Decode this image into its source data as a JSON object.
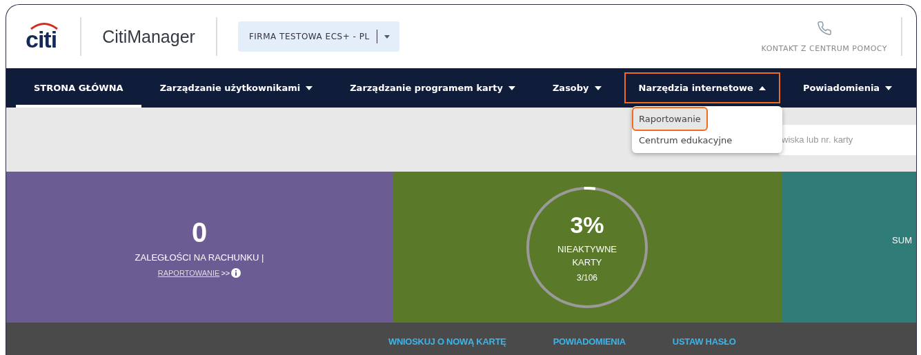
{
  "header": {
    "logo": "citi",
    "app_title": "CitiManager",
    "company_selector": "FIRMA TESTOWA ECS+ - PL",
    "help_link": "KONTAKT Z CENTRUM POMOCY"
  },
  "nav": [
    {
      "label": "STRONA GŁÓWNA",
      "selected": true,
      "has_menu": false,
      "highlighted": false
    },
    {
      "label": "Zarządzanie użytkownikami",
      "selected": false,
      "has_menu": true,
      "expanded": false,
      "highlighted": false
    },
    {
      "label": "Zarządzanie programem karty",
      "selected": false,
      "has_menu": true,
      "expanded": false,
      "highlighted": false
    },
    {
      "label": "Zasoby",
      "selected": false,
      "has_menu": true,
      "expanded": false,
      "highlighted": false
    },
    {
      "label": "Narzędzia internetowe",
      "selected": false,
      "has_menu": true,
      "expanded": true,
      "highlighted": true
    },
    {
      "label": "Powiadomienia",
      "selected": false,
      "has_menu": true,
      "expanded": false,
      "highlighted": false
    }
  ],
  "dropdown": [
    {
      "label": "Raportowanie",
      "selected": true,
      "highlighted": true
    },
    {
      "label": "Centrum edukacyjne",
      "selected": false,
      "highlighted": false
    }
  ],
  "search": {
    "placeholder": "wiska lub nr. karty"
  },
  "tiles": [
    {
      "kind": "count",
      "color": "#6b5c93",
      "value": "0",
      "label": "ZALEGŁOŚCI NA RACHUNKU |",
      "link": "RAPORTOWANIE",
      "suffix": ">>"
    },
    {
      "kind": "ring",
      "color": "#5a7a2a",
      "value": "3%",
      "label": "NIEAKTYWNE",
      "label2": "KARTY",
      "detail": "3/106"
    },
    {
      "kind": "partial",
      "color": "#2f7c78",
      "label": "SUM"
    }
  ],
  "footer_links": [
    "WNIOSKUJ O NOWĄ KARTĘ",
    "POWIADOMIENIA",
    "USTAW HASŁO"
  ]
}
